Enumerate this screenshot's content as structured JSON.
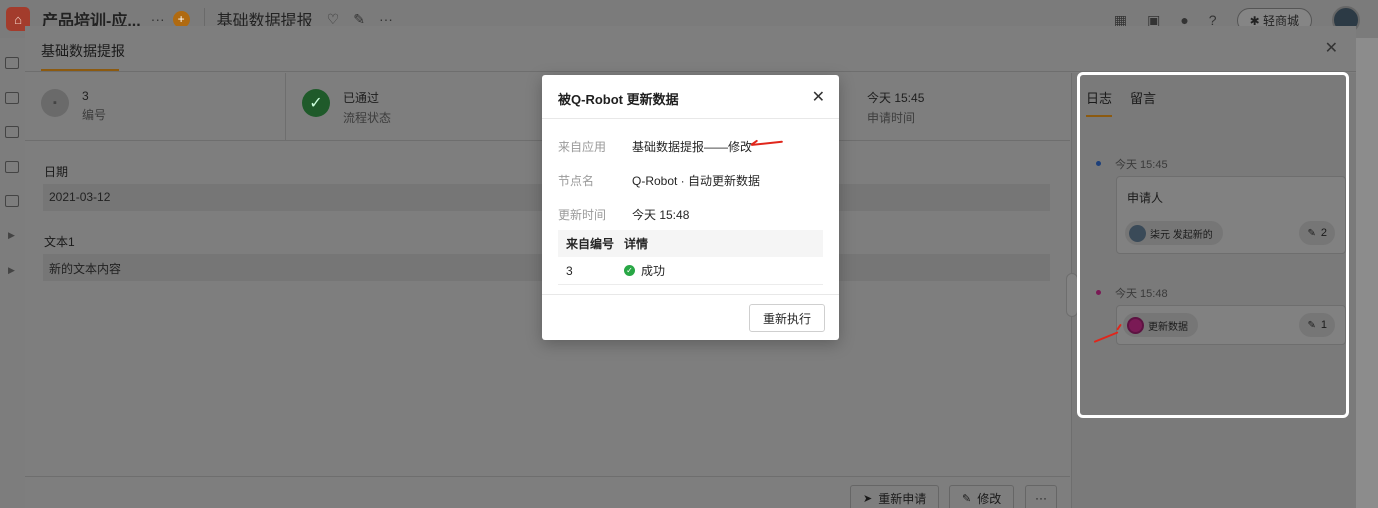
{
  "appbar": {
    "app_title": "产品培训-应...",
    "more": "···",
    "badge": "+",
    "form_title": "基础数据提报",
    "toolbar_more": "···",
    "mall_label": "轻商城"
  },
  "main_modal": {
    "title": "基础数据提报",
    "summary": [
      {
        "value": "3",
        "label": "编号"
      },
      {
        "value": "已通过",
        "label": "流程状态"
      },
      {
        "value": "今天 15:45",
        "label": "申请时间"
      }
    ],
    "fields": [
      {
        "label": "日期",
        "value": "2021-03-12"
      },
      {
        "label": "文本1",
        "value": "新的文本内容"
      }
    ],
    "footer": {
      "reapply": "重新申请",
      "edit": "修改",
      "more": "···"
    }
  },
  "right_panel": {
    "tabs": [
      "日志",
      "留言"
    ],
    "logs": [
      {
        "time": "今天 15:45",
        "title": "申请人",
        "actor": "柒元 发起新的",
        "tool_count": "2",
        "dot_color": "#1c3f7a"
      },
      {
        "time": "今天 15:48",
        "actor": "更新数据",
        "tool_count": "1",
        "dot_color": "#7a1a55"
      }
    ]
  },
  "dialog": {
    "title": "被Q-Robot 更新数据",
    "rows": [
      {
        "label": "来自应用",
        "value": "基础数据提报——修改"
      },
      {
        "label": "节点名",
        "value": "Q-Robot · 自动更新数据"
      },
      {
        "label": "更新时间",
        "value": "今天 15:48"
      }
    ],
    "table": {
      "headers": [
        "来自编号",
        "详情"
      ],
      "row": {
        "id": "3",
        "status": "成功"
      }
    },
    "button": "重新执行"
  },
  "colors": {
    "accent": "#f08c1e",
    "success": "#28a745",
    "annotation_red": "#e0261b",
    "annotation_frame": "#ffffff"
  }
}
